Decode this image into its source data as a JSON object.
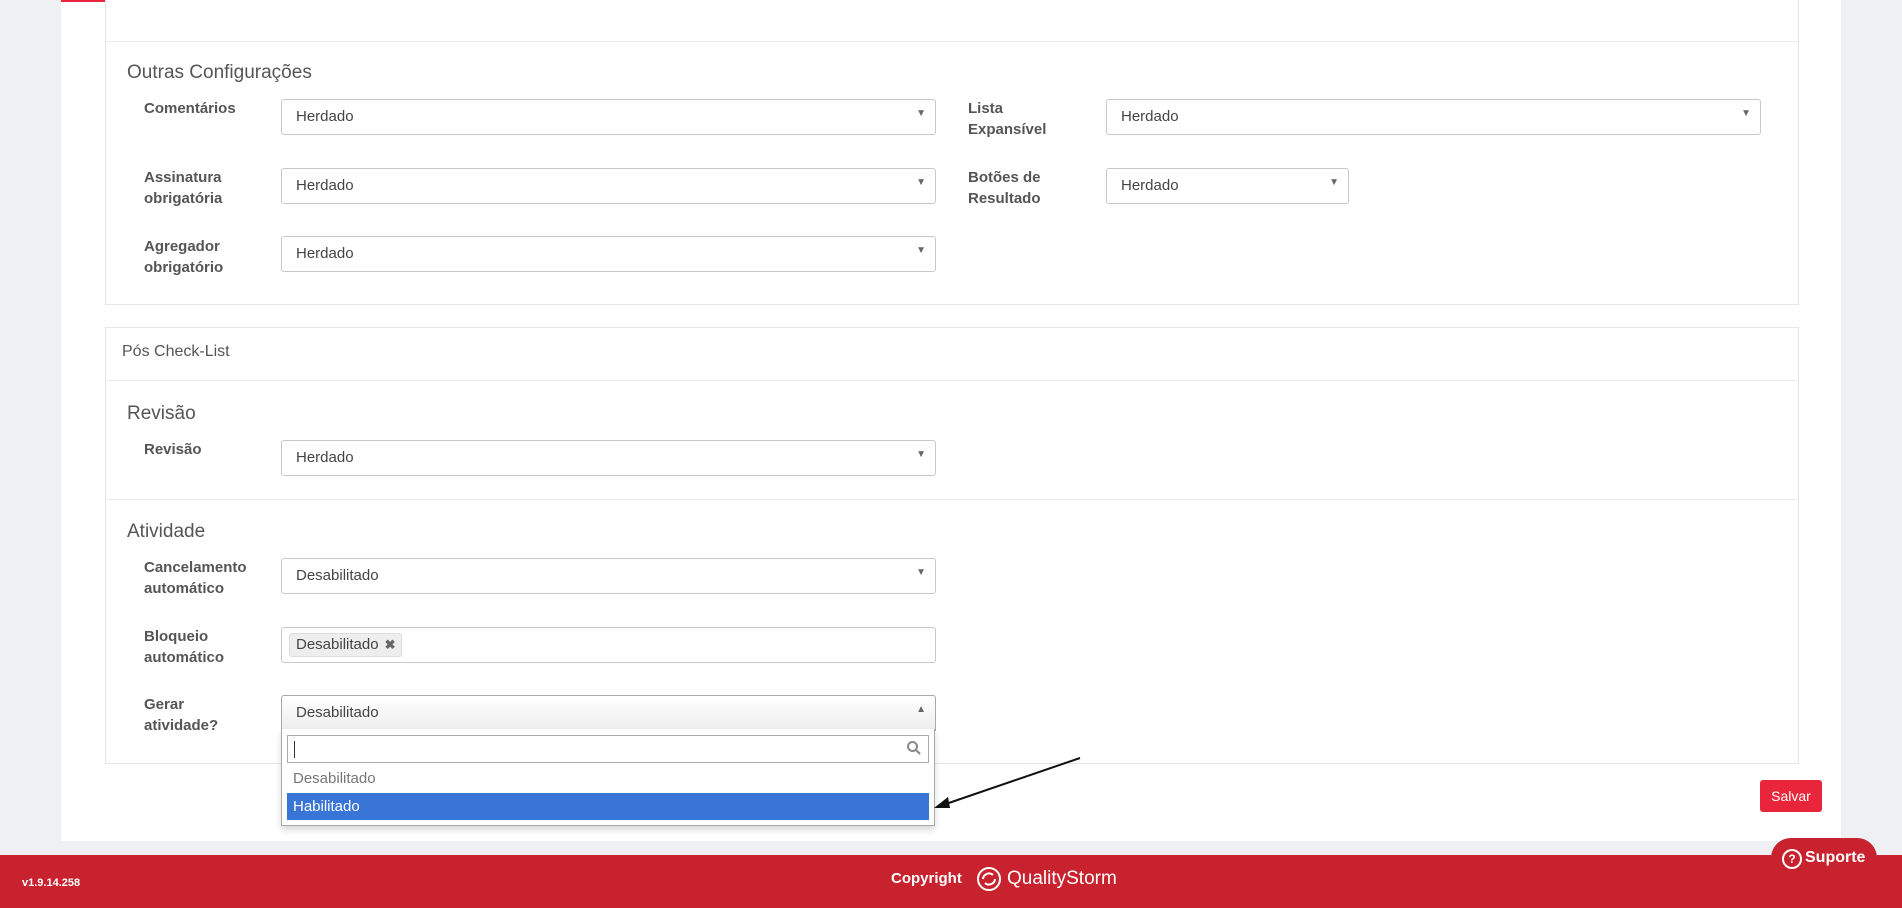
{
  "outras": {
    "title": "Outras Configurações",
    "comentarios": {
      "label": "Comentários",
      "value": "Herdado"
    },
    "lista": {
      "label_line1": "Lista",
      "label_line2": "Expansível",
      "value": "Herdado"
    },
    "assinatura": {
      "label_line1": "Assinatura",
      "label_line2": "obrigatória",
      "value": "Herdado"
    },
    "botoes": {
      "label_line1": "Botões de",
      "label_line2": "Resultado",
      "value": "Herdado"
    },
    "agregador": {
      "label_line1": "Agregador",
      "label_line2": "obrigatório",
      "value": "Herdado"
    }
  },
  "pos_checklist": {
    "heading": "Pós Check-List",
    "revisao_section": "Revisão",
    "revisao": {
      "label": "Revisão",
      "value": "Herdado"
    },
    "atividade_section": "Atividade",
    "cancelamento": {
      "label_line1": "Cancelamento",
      "label_line2": "automático",
      "value": "Desabilitado"
    },
    "bloqueio": {
      "label_line1": "Bloqueio",
      "label_line2": "automático",
      "tag": "Desabilitado"
    },
    "gerar": {
      "label_line1": "Gerar",
      "label_line2": "atividade?",
      "value": "Desabilitado"
    }
  },
  "dropdown": {
    "search_value": "",
    "options": [
      "Desabilitado",
      "Habilitado"
    ],
    "highlighted": "Habilitado"
  },
  "save_label": "Salvar",
  "footer": {
    "version": "v1.9.14.258",
    "copyright": "Copyright",
    "brand": "QualityStorm",
    "support": "Suporte"
  },
  "colors": {
    "accent": "#e8253a",
    "footer": "#c8222e",
    "highlight": "#3875d7"
  }
}
